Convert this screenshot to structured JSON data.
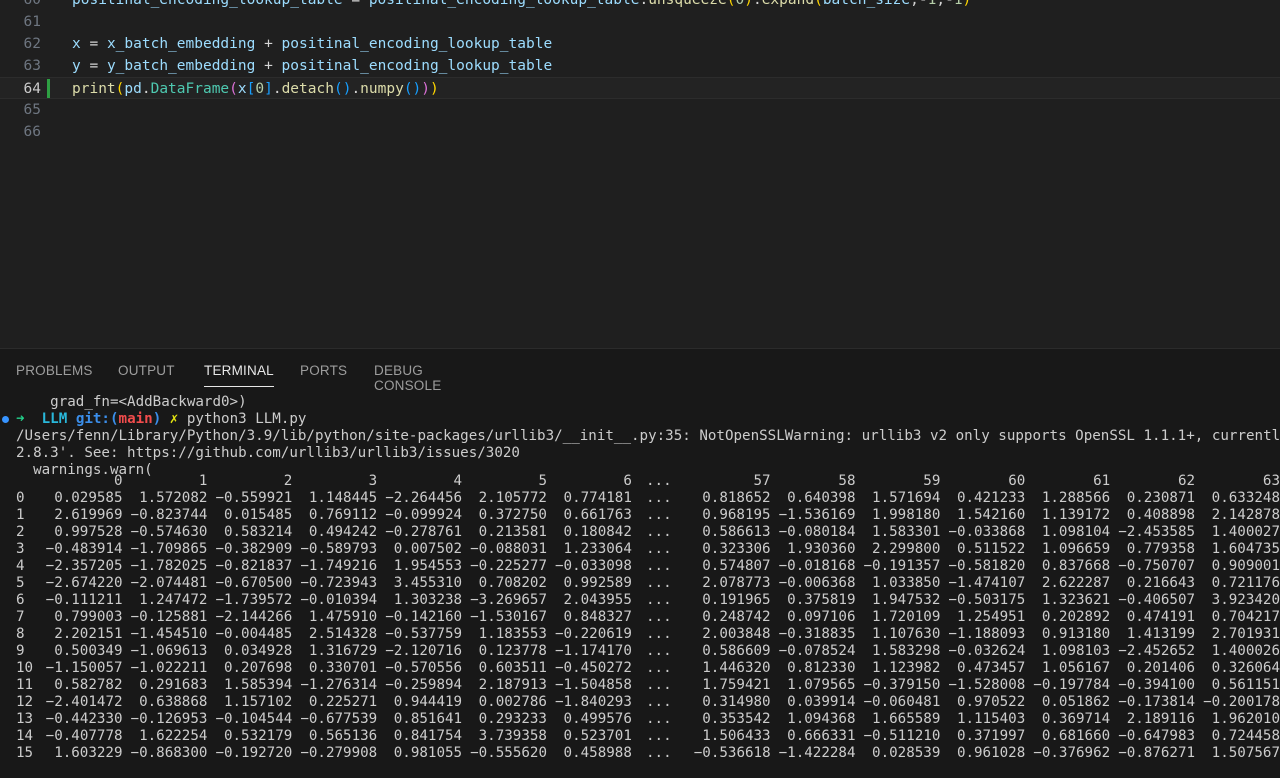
{
  "editor": {
    "lines": [
      {
        "num": "60",
        "tokens": [
          [
            "var",
            "positinal_encoding_lookup_table"
          ],
          [
            "op",
            " = "
          ],
          [
            "var",
            "positinal_encoding_lookup_table"
          ],
          [
            "op",
            "."
          ],
          [
            "fn",
            "unsqueeze"
          ],
          [
            "b1",
            "("
          ],
          [
            "num",
            "0"
          ],
          [
            "b1",
            ")"
          ],
          [
            "op",
            "."
          ],
          [
            "fn",
            "expand"
          ],
          [
            "b1",
            "("
          ],
          [
            "var",
            "batch_size"
          ],
          [
            "op",
            ",-"
          ],
          [
            "num",
            "1"
          ],
          [
            "op",
            ",-"
          ],
          [
            "num",
            "1"
          ],
          [
            "b1",
            ")"
          ]
        ]
      },
      {
        "num": "61",
        "tokens": []
      },
      {
        "num": "62",
        "tokens": [
          [
            "var",
            "x"
          ],
          [
            "op",
            " = "
          ],
          [
            "var",
            "x_batch_embedding"
          ],
          [
            "op",
            " + "
          ],
          [
            "var",
            "positinal_encoding_lookup_table"
          ]
        ]
      },
      {
        "num": "63",
        "tokens": [
          [
            "var",
            "y"
          ],
          [
            "op",
            " = "
          ],
          [
            "var",
            "y_batch_embedding"
          ],
          [
            "op",
            " + "
          ],
          [
            "var",
            "positinal_encoding_lookup_table"
          ]
        ]
      },
      {
        "num": "64",
        "active": true,
        "tokens": [
          [
            "fn",
            "print"
          ],
          [
            "b1",
            "("
          ],
          [
            "var",
            "pd"
          ],
          [
            "op",
            "."
          ],
          [
            "cls",
            "DataFrame"
          ],
          [
            "b2",
            "("
          ],
          [
            "var",
            "x"
          ],
          [
            "b3",
            "["
          ],
          [
            "num",
            "0"
          ],
          [
            "b3",
            "]"
          ],
          [
            "op",
            "."
          ],
          [
            "fn",
            "detach"
          ],
          [
            "b3",
            "()"
          ],
          [
            "op",
            "."
          ],
          [
            "fn",
            "numpy"
          ],
          [
            "b3",
            "()"
          ],
          [
            "b2",
            ")"
          ],
          [
            "b1",
            ")"
          ]
        ]
      },
      {
        "num": "65",
        "tokens": []
      },
      {
        "num": "66",
        "tokens": []
      }
    ]
  },
  "panel": {
    "tabs": [
      "PROBLEMS",
      "OUTPUT",
      "TERMINAL",
      "PORTS",
      "DEBUG CONSOLE"
    ],
    "active_tab": "TERMINAL"
  },
  "terminal": {
    "grad_line": "    grad_fn=<AddBackward0>)",
    "prompt": {
      "arrow": "➜",
      "dir": "LLM",
      "git_label": "git:(",
      "branch": "main",
      "git_close": ")",
      "dirty": "✗",
      "command": "python3 LLM.py"
    },
    "warning_line1": "/Users/fenn/Library/Python/3.9/lib/python/site-packages/urllib3/__init__.py:35: NotOpenSSLWarning: urllib3 v2 only supports OpenSSL 1.1.1+, currently",
    "warning_line2": "2.8.3'. See: https://github.com/urllib3/urllib3/issues/3020",
    "warning_line3": "  warnings.warn(",
    "columns": [
      "0",
      "1",
      "2",
      "3",
      "4",
      "5",
      "6",
      "...",
      "57",
      "58",
      "59",
      "60",
      "61",
      "62",
      "63"
    ],
    "rows": [
      [
        "0",
        "0.029585",
        "1.572082",
        "-0.559921",
        "1.148445",
        "-2.264456",
        "2.105772",
        "0.774181",
        "...",
        "0.818652",
        "0.640398",
        "1.571694",
        "0.421233",
        "1.288566",
        "0.230871",
        "0.633248"
      ],
      [
        "1",
        "2.619969",
        "-0.823744",
        "0.015485",
        "0.769112",
        "-0.099924",
        "0.372750",
        "0.661763",
        "...",
        "0.968195",
        "-1.536169",
        "1.998180",
        "1.542160",
        "1.139172",
        "0.408898",
        "2.142878"
      ],
      [
        "2",
        "0.997528",
        "-0.574630",
        "0.583214",
        "0.494242",
        "-0.278761",
        "0.213581",
        "0.180842",
        "...",
        "0.586613",
        "-0.080184",
        "1.583301",
        "-0.033868",
        "1.098104",
        "-2.453585",
        "1.400027"
      ],
      [
        "3",
        "-0.483914",
        "-1.709865",
        "-0.382909",
        "-0.589793",
        "0.007502",
        "-0.088031",
        "1.233064",
        "...",
        "0.323306",
        "1.930360",
        "2.299800",
        "0.511522",
        "1.096659",
        "0.779358",
        "1.604735"
      ],
      [
        "4",
        "-2.357205",
        "-1.782025",
        "-0.821837",
        "-1.749216",
        "1.954553",
        "-0.225277",
        "-0.033098",
        "...",
        "0.574807",
        "-0.018168",
        "-0.191357",
        "-0.581820",
        "0.837668",
        "-0.750707",
        "0.909001"
      ],
      [
        "5",
        "-2.674220",
        "-2.074481",
        "-0.670500",
        "-0.723943",
        "3.455310",
        "0.708202",
        "0.992589",
        "...",
        "2.078773",
        "-0.006368",
        "1.033850",
        "-1.474107",
        "2.622287",
        "0.216643",
        "0.721176"
      ],
      [
        "6",
        "-0.111211",
        "1.247472",
        "-1.739572",
        "-0.010394",
        "1.303238",
        "-3.269657",
        "2.043955",
        "...",
        "0.191965",
        "0.375819",
        "1.947532",
        "-0.503175",
        "1.323621",
        "-0.406507",
        "3.923420"
      ],
      [
        "7",
        "0.799003",
        "-0.125881",
        "-2.144266",
        "1.475910",
        "-0.142160",
        "-1.530167",
        "0.848327",
        "...",
        "0.248742",
        "0.097106",
        "1.720109",
        "1.254951",
        "0.202892",
        "0.474191",
        "0.704217"
      ],
      [
        "8",
        "2.202151",
        "-1.454510",
        "-0.004485",
        "2.514328",
        "-0.537759",
        "1.183553",
        "-0.220619",
        "...",
        "2.003848",
        "-0.318835",
        "1.107630",
        "-1.188093",
        "0.913180",
        "1.413199",
        "2.701931"
      ],
      [
        "9",
        "0.500349",
        "-1.069613",
        "0.034928",
        "1.316729",
        "-2.120716",
        "0.123778",
        "-1.174170",
        "...",
        "0.586609",
        "-0.078524",
        "1.583298",
        "-0.032624",
        "1.098103",
        "-2.452652",
        "1.400026"
      ],
      [
        "10",
        "-1.150057",
        "-1.022211",
        "0.207698",
        "0.330701",
        "-0.570556",
        "0.603511",
        "-0.450272",
        "...",
        "1.446320",
        "0.812330",
        "1.123982",
        "0.473457",
        "1.056167",
        "0.201406",
        "0.326064"
      ],
      [
        "11",
        "0.582782",
        "0.291683",
        "1.585394",
        "-1.276314",
        "-0.259894",
        "2.187913",
        "-1.504858",
        "...",
        "1.759421",
        "1.079565",
        "-0.379150",
        "-1.528008",
        "-0.197784",
        "-0.394100",
        "0.561151"
      ],
      [
        "12",
        "-2.401472",
        "0.638868",
        "1.157102",
        "0.225271",
        "0.944419",
        "0.002786",
        "-1.840293",
        "...",
        "0.314980",
        "0.039914",
        "-0.060481",
        "0.970522",
        "0.051862",
        "-0.173814",
        "-0.200178"
      ],
      [
        "13",
        "-0.442330",
        "-0.126953",
        "-0.104544",
        "-0.677539",
        "0.851641",
        "0.293233",
        "0.499576",
        "...",
        "0.353542",
        "1.094368",
        "1.665589",
        "1.115403",
        "0.369714",
        "2.189116",
        "1.962010"
      ],
      [
        "14",
        "-0.407778",
        "1.622254",
        "0.532179",
        "0.565136",
        "0.841754",
        "3.739358",
        "0.523701",
        "...",
        "1.506433",
        "0.666331",
        "-0.511210",
        "0.371997",
        "0.681660",
        "-0.647983",
        "0.724458"
      ],
      [
        "15",
        "1.603229",
        "-0.868300",
        "-0.192720",
        "-0.279908",
        "0.981055",
        "-0.555620",
        "0.458988",
        "...",
        "-0.536618",
        "-1.422284",
        "0.028539",
        "0.961028",
        "-0.376962",
        "-0.876271",
        "1.507567"
      ]
    ]
  }
}
